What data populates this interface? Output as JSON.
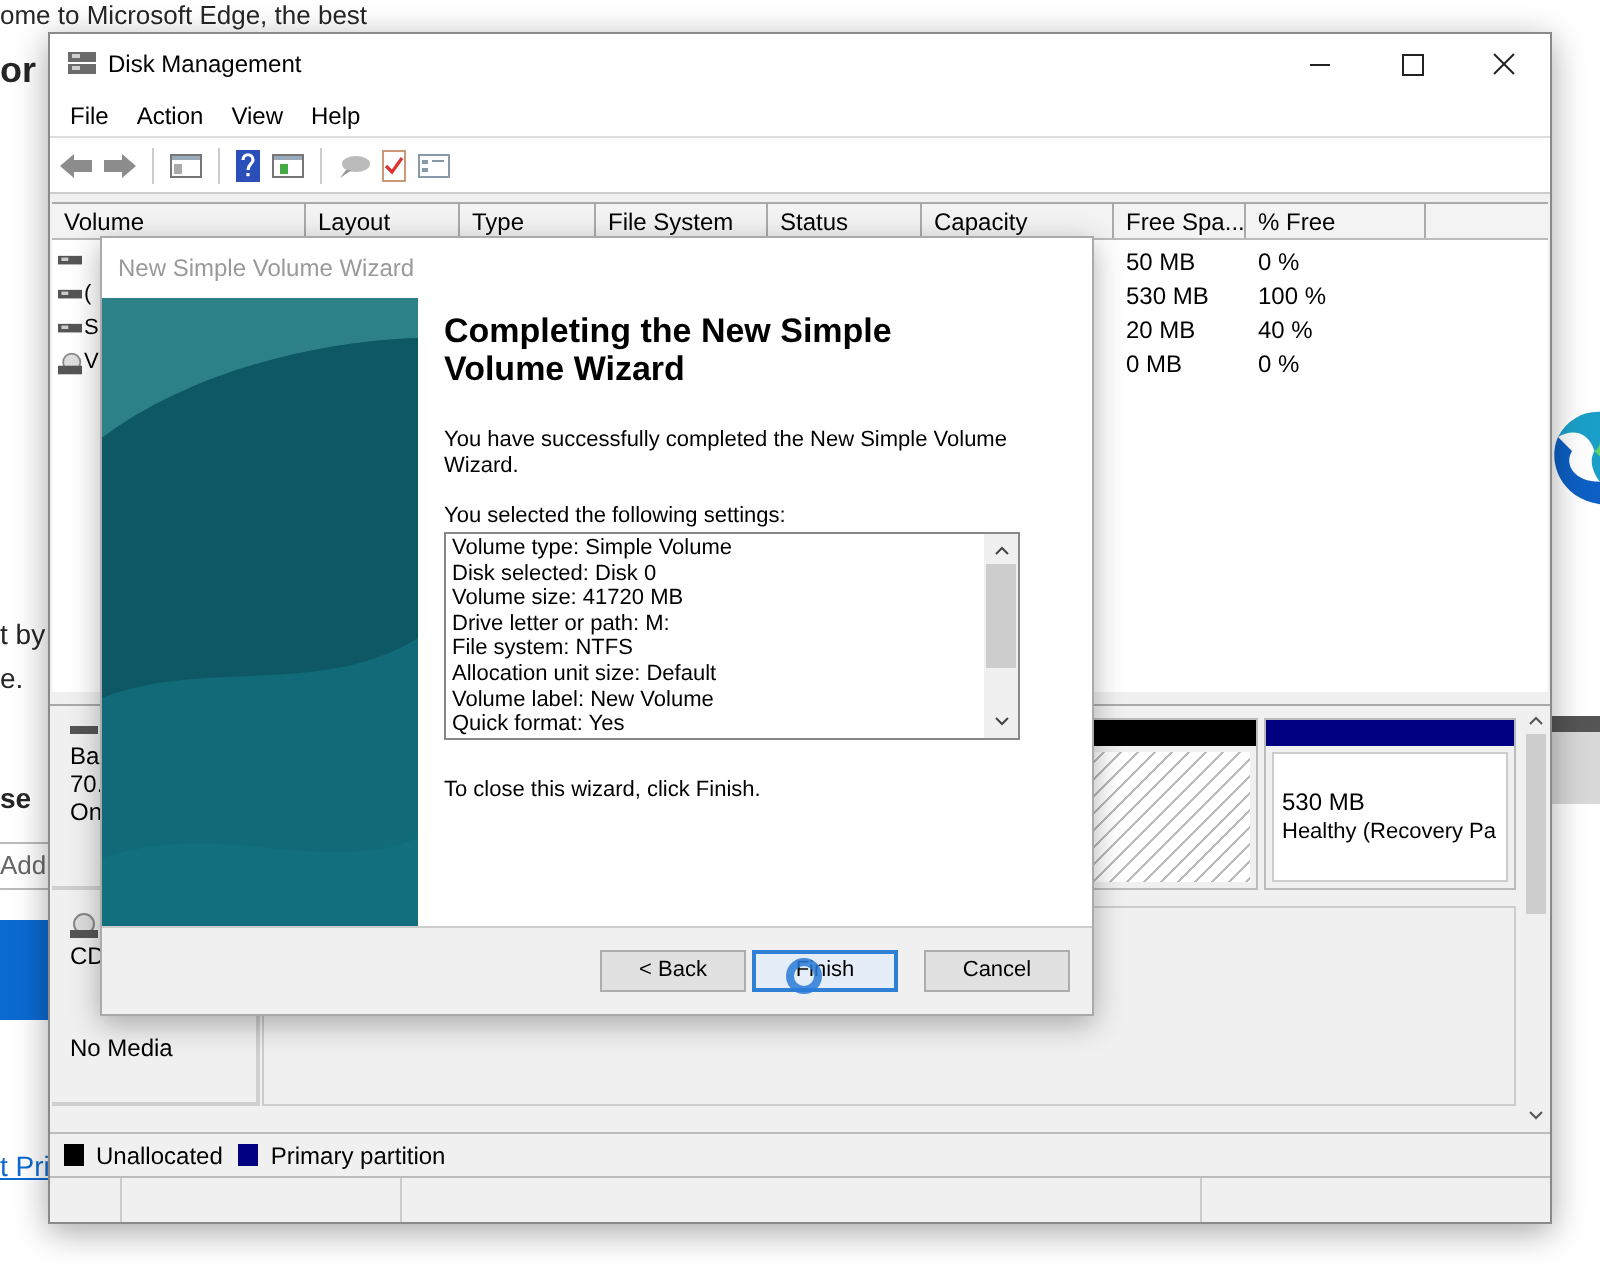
{
  "background_page": {
    "heading": "ome to Microsoft Edge, the best",
    "heading_2": "or",
    "paragraph_lines": [
      "t by",
      "e."
    ],
    "subheading": "se",
    "field_placeholder": "Add",
    "link": "t Pri"
  },
  "window": {
    "title": "Disk Management"
  },
  "menu": [
    "File",
    "Action",
    "View",
    "Help"
  ],
  "volume_list": {
    "columns": [
      "Volume",
      "Layout",
      "Type",
      "File System",
      "Status",
      "Capacity",
      "Free Spa...",
      "% Free"
    ],
    "rows": [
      {
        "kind": "drive",
        "free": "50 MB",
        "percent_free": "0 %"
      },
      {
        "kind": "drive",
        "volume": "(",
        "free": "530 MB",
        "percent_free": "100 %"
      },
      {
        "kind": "drive",
        "volume": "S",
        "free": "20 MB",
        "percent_free": "40 %"
      },
      {
        "kind": "optical",
        "volume": "V",
        "free": "0 MB",
        "percent_free": "0 %"
      }
    ]
  },
  "disks": [
    {
      "kind": "basic",
      "lines": [
        "Ba",
        "70.",
        "On"
      ],
      "partitions": [
        {
          "kind": "unallocated",
          "color": "#000000"
        },
        {
          "kind": "primary",
          "color": "#000080",
          "size": "530 MB",
          "status": "Healthy (Recovery Pa"
        }
      ]
    },
    {
      "kind": "cdrom",
      "lines": [
        "CD"
      ],
      "media": "No Media"
    }
  ],
  "legend": [
    {
      "label": "Unallocated",
      "color": "#000000"
    },
    {
      "label": "Primary partition",
      "color": "#000080"
    }
  ],
  "wizard": {
    "title": "New Simple Volume Wizard",
    "heading": "Completing the New Simple Volume Wizard",
    "message": "You have successfully completed the New Simple Volume Wizard.",
    "settings_label": "You selected the following settings:",
    "settings": [
      "Volume type: Simple Volume",
      "Disk selected: Disk 0",
      "Volume size: 41720 MB",
      "Drive letter or path: M:",
      "File system: NTFS",
      "Allocation unit size: Default",
      "Volume label: New Volume",
      "Quick format: Yes"
    ],
    "closing_note": "To close this wizard, click Finish.",
    "buttons": [
      {
        "label": "< Back",
        "focused": false
      },
      {
        "label": "Finish",
        "focused": true
      },
      {
        "label": "Cancel",
        "focused": false
      }
    ]
  }
}
